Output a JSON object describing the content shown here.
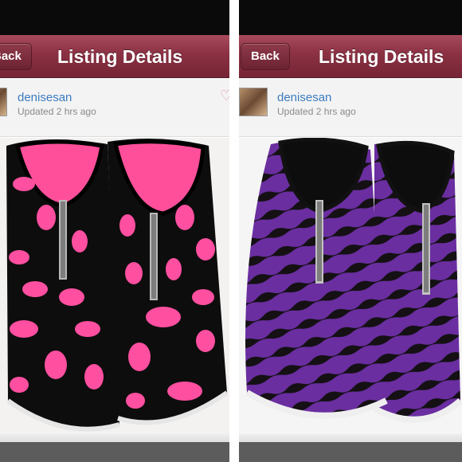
{
  "panels": [
    {
      "id": "left",
      "back_label": "Back",
      "title": "Listing Details",
      "username": "denisesan",
      "updated": "Updated 2 hrs ago",
      "photo": "black-slip-on-sneakers-with-pink-lip-print-and-zipper"
    },
    {
      "id": "right",
      "back_label": "Back",
      "title": "Listing Details",
      "username": "denisesan",
      "updated": "Updated 2 hrs ago",
      "photo": "purple-zebra-slip-on-sneakers-with-zipper"
    }
  ],
  "icons": {
    "like": "heart-icon",
    "avatar": "user-avatar"
  },
  "colors": {
    "navbar": "#8a3143",
    "username_link": "#3b7bbf",
    "lip_pink": "#ff4fa0",
    "zebra_purple": "#6a2ea0"
  }
}
